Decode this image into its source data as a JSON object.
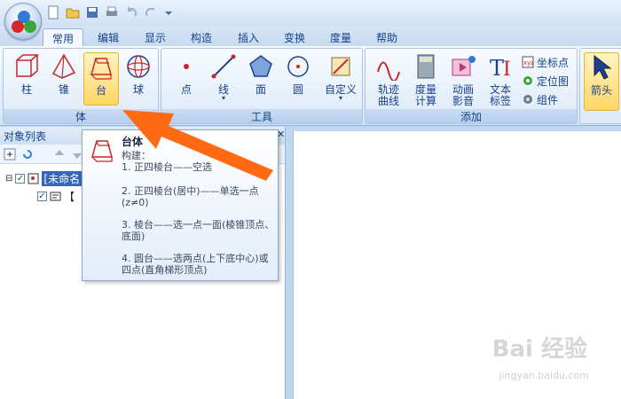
{
  "tabs": [
    "常用",
    "编辑",
    "显示",
    "构造",
    "插入",
    "变换",
    "度量",
    "帮助"
  ],
  "ribbon": {
    "groups": {
      "body": "体",
      "tools": "工具",
      "add": "添加"
    },
    "body_buttons": [
      "柱",
      "锥",
      "台",
      "球"
    ],
    "tool_buttons": [
      "点",
      "线",
      "面",
      "圆"
    ],
    "custom_button": "自定义",
    "add_buttons": [
      "轨迹\n曲线",
      "度量\n计算",
      "动画\n影音",
      "文本\n标签"
    ],
    "add_small": [
      "坐标点",
      "定位图",
      "组件"
    ],
    "arrow_button": "箭头"
  },
  "panel": {
    "title": "对象列表",
    "tree_root": "[未命名",
    "tree_child": "【"
  },
  "tooltip": {
    "title": "台体",
    "subtitle": "构建：",
    "lines": [
      "1. 正四棱台——空选",
      "2. 正四棱台(居中)——单选一点(z≠0)",
      "3. 棱台——选一点一面(棱锥顶点、底面)",
      "4. 圆台——选两点(上下底中心)或四点(直角梯形顶点)"
    ]
  },
  "watermark": {
    "brand": "Bai 经验",
    "url": "jingyan.baidu.com"
  },
  "colors": {
    "accent": "#ff6a13",
    "ribbon_text": "#15428b",
    "selected": "#ffd666"
  }
}
